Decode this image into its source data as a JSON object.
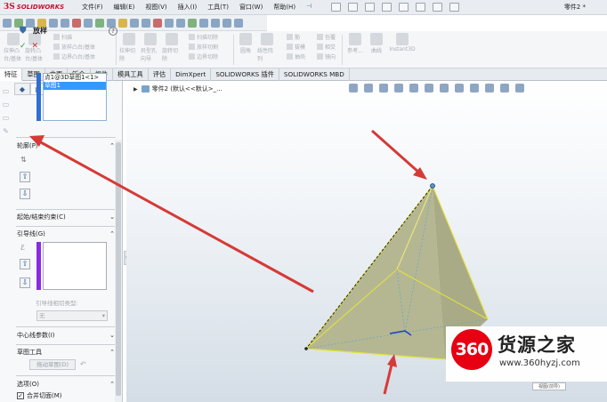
{
  "app": {
    "logo_ds": "3S",
    "logo_name": "SOLIDWORKS",
    "document_title": "零件2 *"
  },
  "menu": [
    "文件(F)",
    "编辑(E)",
    "视图(V)",
    "插入(I)",
    "工具(T)",
    "窗口(W)",
    "帮助(H)"
  ],
  "command_manager": {
    "group1": [
      "拉伸凸台/基体",
      "旋转凸台/基体"
    ],
    "group1_list": [
      "扫描",
      "放样凸台/基体",
      "边界凸台/基体"
    ],
    "group2": [
      "拉伸切除",
      "异型孔向导",
      "旋转切除"
    ],
    "group2_list": [
      "扫描切除",
      "放样切割",
      "边界切除"
    ],
    "group3": [
      "圆角",
      "线性阵列"
    ],
    "group3_list": [
      "筋",
      "拔模",
      "抽壳"
    ],
    "group3_list2": [
      "包覆",
      "相交",
      "镜向"
    ],
    "group4": [
      "参考...",
      "曲线",
      "Instant3D"
    ]
  },
  "tabs": [
    "特征",
    "草图",
    "曲面",
    "钣金",
    "焊件",
    "模具工具",
    "评估",
    "DimXpert",
    "SOLIDWORKS 插件",
    "SOLIDWORKS MBD"
  ],
  "tree": {
    "item": "零件2 (默认<<默认>_..."
  },
  "panel": {
    "feature_name": "放样",
    "ok": "✓",
    "cancel": "✕",
    "help": "?",
    "profiles_title": "轮廓(P)",
    "profiles": [
      "点1@3D草图1<1>",
      "草图1"
    ],
    "start_end": "起始/结束约束(C)",
    "guides_title": "引导线(G)",
    "guide_tangency_label": "引导线相切类型:",
    "guide_tangency_value": "无",
    "centerline": "中心线参数(I)",
    "sketch_tools": "草图工具",
    "drag_sketch": "拖动草图(D)",
    "options": "选项(O)",
    "merge_faces": "合并切面(M)"
  },
  "viewport": {
    "triad_label": "视图(前导)"
  },
  "watermark": {
    "logo": "360",
    "name": "货源之家",
    "url": "www.360hyzj.com"
  },
  "colors": {
    "arrow": "#d63a36",
    "solid_fill": "#b7b995",
    "selection_edge": "#e8e53a",
    "watermark_red": "#e60012"
  }
}
